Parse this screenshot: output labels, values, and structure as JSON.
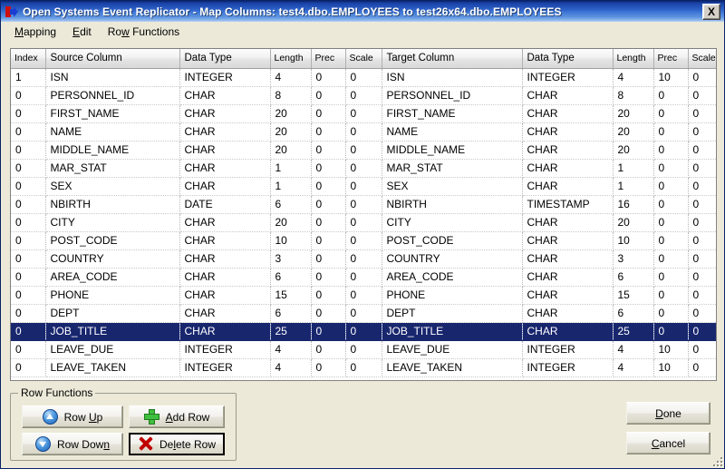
{
  "window": {
    "title": "Open Systems Event Replicator - Map Columns:   test4.dbo.EMPLOYEES  to  test26x64.dbo.EMPLOYEES",
    "app_icon": "replicator-icon",
    "close_label": "X",
    "titlebar_color": "#1941a5",
    "face_color": "#ece9d8"
  },
  "menubar": {
    "items": [
      {
        "label": "Mapping",
        "mnemonic": "M"
      },
      {
        "label": "Edit",
        "mnemonic": "E"
      },
      {
        "label": "Row Functions",
        "mnemonic": "w"
      }
    ]
  },
  "grid": {
    "selection_color": "#18266e",
    "headers": [
      "Index",
      "Source Column",
      "Data Type",
      "Length",
      "Prec",
      "Scale",
      "Target Column",
      "Data Type",
      "Length",
      "Prec",
      "Scale"
    ],
    "rows": [
      {
        "selected": false,
        "cells": [
          "1",
          "ISN",
          "INTEGER",
          "4",
          "0",
          "0",
          "ISN",
          "INTEGER",
          "4",
          "10",
          "0"
        ]
      },
      {
        "selected": false,
        "cells": [
          "0",
          "PERSONNEL_ID",
          "CHAR",
          "8",
          "0",
          "0",
          "PERSONNEL_ID",
          "CHAR",
          "8",
          "0",
          "0"
        ]
      },
      {
        "selected": false,
        "cells": [
          "0",
          "FIRST_NAME",
          "CHAR",
          "20",
          "0",
          "0",
          "FIRST_NAME",
          "CHAR",
          "20",
          "0",
          "0"
        ]
      },
      {
        "selected": false,
        "cells": [
          "0",
          "NAME",
          "CHAR",
          "20",
          "0",
          "0",
          "NAME",
          "CHAR",
          "20",
          "0",
          "0"
        ]
      },
      {
        "selected": false,
        "cells": [
          "0",
          "MIDDLE_NAME",
          "CHAR",
          "20",
          "0",
          "0",
          "MIDDLE_NAME",
          "CHAR",
          "20",
          "0",
          "0"
        ]
      },
      {
        "selected": false,
        "cells": [
          "0",
          "MAR_STAT",
          "CHAR",
          "1",
          "0",
          "0",
          "MAR_STAT",
          "CHAR",
          "1",
          "0",
          "0"
        ]
      },
      {
        "selected": false,
        "cells": [
          "0",
          "SEX",
          "CHAR",
          "1",
          "0",
          "0",
          "SEX",
          "CHAR",
          "1",
          "0",
          "0"
        ]
      },
      {
        "selected": false,
        "cells": [
          "0",
          "NBIRTH",
          "DATE",
          "6",
          "0",
          "0",
          "NBIRTH",
          "TIMESTAMP",
          "16",
          "0",
          "0"
        ]
      },
      {
        "selected": false,
        "cells": [
          "0",
          "CITY",
          "CHAR",
          "20",
          "0",
          "0",
          "CITY",
          "CHAR",
          "20",
          "0",
          "0"
        ]
      },
      {
        "selected": false,
        "cells": [
          "0",
          "POST_CODE",
          "CHAR",
          "10",
          "0",
          "0",
          "POST_CODE",
          "CHAR",
          "10",
          "0",
          "0"
        ]
      },
      {
        "selected": false,
        "cells": [
          "0",
          "COUNTRY",
          "CHAR",
          "3",
          "0",
          "0",
          "COUNTRY",
          "CHAR",
          "3",
          "0",
          "0"
        ]
      },
      {
        "selected": false,
        "cells": [
          "0",
          "AREA_CODE",
          "CHAR",
          "6",
          "0",
          "0",
          "AREA_CODE",
          "CHAR",
          "6",
          "0",
          "0"
        ]
      },
      {
        "selected": false,
        "cells": [
          "0",
          "PHONE",
          "CHAR",
          "15",
          "0",
          "0",
          "PHONE",
          "CHAR",
          "15",
          "0",
          "0"
        ]
      },
      {
        "selected": false,
        "cells": [
          "0",
          "DEPT",
          "CHAR",
          "6",
          "0",
          "0",
          "DEPT",
          "CHAR",
          "6",
          "0",
          "0"
        ]
      },
      {
        "selected": true,
        "cells": [
          "0",
          "JOB_TITLE",
          "CHAR",
          "25",
          "0",
          "0",
          "JOB_TITLE",
          "CHAR",
          "25",
          "0",
          "0"
        ]
      },
      {
        "selected": false,
        "cells": [
          "0",
          "LEAVE_DUE",
          "INTEGER",
          "4",
          "0",
          "0",
          "LEAVE_DUE",
          "INTEGER",
          "4",
          "10",
          "0"
        ]
      },
      {
        "selected": false,
        "cells": [
          "0",
          "LEAVE_TAKEN",
          "INTEGER",
          "4",
          "0",
          "0",
          "LEAVE_TAKEN",
          "INTEGER",
          "4",
          "10",
          "0"
        ]
      }
    ]
  },
  "row_functions": {
    "legend": "Row Functions",
    "buttons": {
      "row_up": {
        "label": "Row Up",
        "mnemonic": "U",
        "icon": "arrow-up-circle-icon"
      },
      "row_down": {
        "label": "Row Down",
        "mnemonic": "n",
        "icon": "arrow-down-circle-icon"
      },
      "add_row": {
        "label": "Add Row",
        "mnemonic": "A",
        "icon": "plus-icon"
      },
      "delete_row": {
        "label": "Delete Row",
        "mnemonic": "l",
        "icon": "delete-x-icon",
        "focused": true
      }
    }
  },
  "dialog_buttons": {
    "done": {
      "label": "Done",
      "mnemonic": "D"
    },
    "cancel": {
      "label": "Cancel",
      "mnemonic": "C"
    }
  }
}
